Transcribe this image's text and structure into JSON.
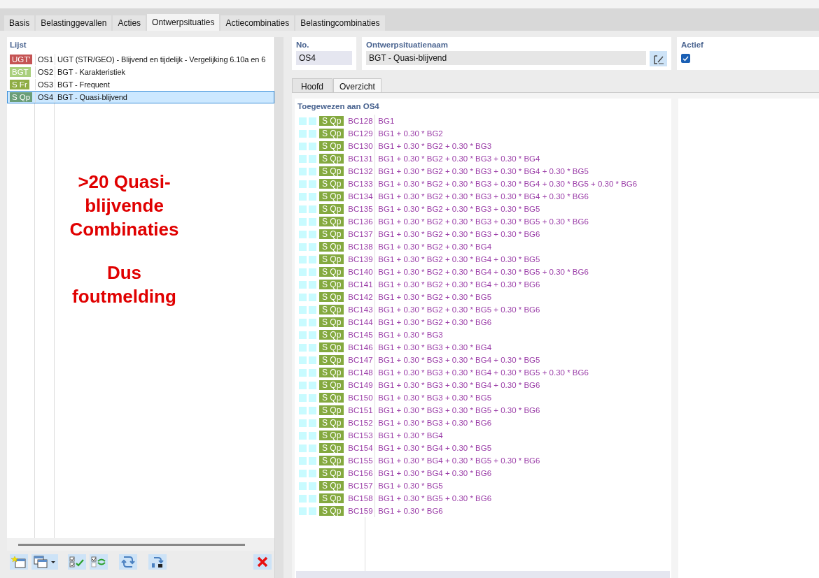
{
  "tabs": [
    {
      "label": "Basis",
      "selected": false
    },
    {
      "label": "Belastinggevallen",
      "selected": false
    },
    {
      "label": "Acties",
      "selected": false
    },
    {
      "label": "Ontwerpsituaties",
      "selected": true
    },
    {
      "label": "Actiecombinaties",
      "selected": false
    },
    {
      "label": "Belastingcombinaties",
      "selected": false
    }
  ],
  "list": {
    "title": "Lijst",
    "items": [
      {
        "badge": "UGT'",
        "color": "#c55454",
        "code": "OS1",
        "name": "UGT (STR/GEO) - Blijvend en tijdelijk - Vergelijking 6.10a en 6",
        "selected": false
      },
      {
        "badge": "BGT",
        "color": "#a9cf7c",
        "code": "OS2",
        "name": "BGT - Karakteristiek",
        "selected": false
      },
      {
        "badge": "S Fr",
        "color": "#8fad45",
        "code": "OS3",
        "name": "BGT - Frequent",
        "selected": false
      },
      {
        "badge": "S Qp",
        "color": "#6a9e78",
        "code": "OS4",
        "name": "BGT - Quasi-blijvend",
        "selected": true
      }
    ]
  },
  "annotation": {
    "lines": [
      ">20 Quasi-blijvende Combinaties",
      "Dus foutmelding"
    ]
  },
  "no": {
    "label": "No.",
    "value": "OS4"
  },
  "name_field": {
    "label": "Ontwerpsituatienaam",
    "value": "BGT - Quasi-blijvend"
  },
  "active": {
    "label": "Actief",
    "checked": true
  },
  "subtabs": [
    {
      "label": "Hoofd",
      "selected": false
    },
    {
      "label": "Overzicht",
      "selected": true
    }
  ],
  "assigned": {
    "title": "Toegewezen aan OS4",
    "rows": [
      {
        "badge": "S Qp",
        "id": "BC128",
        "formula": "BG1"
      },
      {
        "badge": "S Qp",
        "id": "BC129",
        "formula": "BG1 + 0.30 * BG2"
      },
      {
        "badge": "S Qp",
        "id": "BC130",
        "formula": "BG1 + 0.30 * BG2 + 0.30 * BG3"
      },
      {
        "badge": "S Qp",
        "id": "BC131",
        "formula": "BG1 + 0.30 * BG2 + 0.30 * BG3 + 0.30 * BG4"
      },
      {
        "badge": "S Qp",
        "id": "BC132",
        "formula": "BG1 + 0.30 * BG2 + 0.30 * BG3 + 0.30 * BG4 + 0.30 * BG5"
      },
      {
        "badge": "S Qp",
        "id": "BC133",
        "formula": "BG1 + 0.30 * BG2 + 0.30 * BG3 + 0.30 * BG4 + 0.30 * BG5 + 0.30 * BG6"
      },
      {
        "badge": "S Qp",
        "id": "BC134",
        "formula": "BG1 + 0.30 * BG2 + 0.30 * BG3 + 0.30 * BG4 + 0.30 * BG6"
      },
      {
        "badge": "S Qp",
        "id": "BC135",
        "formula": "BG1 + 0.30 * BG2 + 0.30 * BG3 + 0.30 * BG5"
      },
      {
        "badge": "S Qp",
        "id": "BC136",
        "formula": "BG1 + 0.30 * BG2 + 0.30 * BG3 + 0.30 * BG5 + 0.30 * BG6"
      },
      {
        "badge": "S Qp",
        "id": "BC137",
        "formula": "BG1 + 0.30 * BG2 + 0.30 * BG3 + 0.30 * BG6"
      },
      {
        "badge": "S Qp",
        "id": "BC138",
        "formula": "BG1 + 0.30 * BG2 + 0.30 * BG4"
      },
      {
        "badge": "S Qp",
        "id": "BC139",
        "formula": "BG1 + 0.30 * BG2 + 0.30 * BG4 + 0.30 * BG5"
      },
      {
        "badge": "S Qp",
        "id": "BC140",
        "formula": "BG1 + 0.30 * BG2 + 0.30 * BG4 + 0.30 * BG5 + 0.30 * BG6"
      },
      {
        "badge": "S Qp",
        "id": "BC141",
        "formula": "BG1 + 0.30 * BG2 + 0.30 * BG4 + 0.30 * BG6"
      },
      {
        "badge": "S Qp",
        "id": "BC142",
        "formula": "BG1 + 0.30 * BG2 + 0.30 * BG5"
      },
      {
        "badge": "S Qp",
        "id": "BC143",
        "formula": "BG1 + 0.30 * BG2 + 0.30 * BG5 + 0.30 * BG6"
      },
      {
        "badge": "S Qp",
        "id": "BC144",
        "formula": "BG1 + 0.30 * BG2 + 0.30 * BG6"
      },
      {
        "badge": "S Qp",
        "id": "BC145",
        "formula": "BG1 + 0.30 * BG3"
      },
      {
        "badge": "S Qp",
        "id": "BC146",
        "formula": "BG1 + 0.30 * BG3 + 0.30 * BG4"
      },
      {
        "badge": "S Qp",
        "id": "BC147",
        "formula": "BG1 + 0.30 * BG3 + 0.30 * BG4 + 0.30 * BG5"
      },
      {
        "badge": "S Qp",
        "id": "BC148",
        "formula": "BG1 + 0.30 * BG3 + 0.30 * BG4 + 0.30 * BG5 + 0.30 * BG6"
      },
      {
        "badge": "S Qp",
        "id": "BC149",
        "formula": "BG1 + 0.30 * BG3 + 0.30 * BG4 + 0.30 * BG6"
      },
      {
        "badge": "S Qp",
        "id": "BC150",
        "formula": "BG1 + 0.30 * BG3 + 0.30 * BG5"
      },
      {
        "badge": "S Qp",
        "id": "BC151",
        "formula": "BG1 + 0.30 * BG3 + 0.30 * BG5 + 0.30 * BG6"
      },
      {
        "badge": "S Qp",
        "id": "BC152",
        "formula": "BG1 + 0.30 * BG3 + 0.30 * BG6"
      },
      {
        "badge": "S Qp",
        "id": "BC153",
        "formula": "BG1 + 0.30 * BG4"
      },
      {
        "badge": "S Qp",
        "id": "BC154",
        "formula": "BG1 + 0.30 * BG4 + 0.30 * BG5"
      },
      {
        "badge": "S Qp",
        "id": "BC155",
        "formula": "BG1 + 0.30 * BG4 + 0.30 * BG5 + 0.30 * BG6"
      },
      {
        "badge": "S Qp",
        "id": "BC156",
        "formula": "BG1 + 0.30 * BG4 + 0.30 * BG6"
      },
      {
        "badge": "S Qp",
        "id": "BC157",
        "formula": "BG1 + 0.30 * BG5"
      },
      {
        "badge": "S Qp",
        "id": "BC158",
        "formula": "BG1 + 0.30 * BG5 + 0.30 * BG6"
      },
      {
        "badge": "S Qp",
        "id": "BC159",
        "formula": "BG1 + 0.30 * BG6"
      }
    ]
  }
}
